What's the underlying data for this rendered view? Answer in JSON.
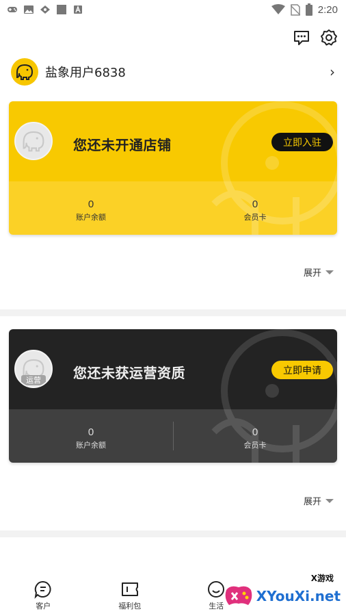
{
  "status_bar": {
    "time": "2:20",
    "left_icons": [
      "gamepad-icon",
      "image-icon",
      "signal-app-icon",
      "square-icon",
      "text-a-icon"
    ],
    "right_icons": [
      "wifi-icon",
      "no-sim-icon",
      "battery-icon"
    ]
  },
  "header": {
    "icons": [
      "message-icon",
      "settings-gear-icon"
    ]
  },
  "profile": {
    "username": "盐象用户6838",
    "accent": "#f8c901"
  },
  "shop_card": {
    "title": "您还未开通店铺",
    "button": "立即入驻",
    "stats": [
      {
        "value": "0",
        "label": "账户余额"
      },
      {
        "value": "0",
        "label": "会员卡"
      }
    ],
    "expand": "展开"
  },
  "ops_card": {
    "badge": "运营",
    "title": "您还未获运营资质",
    "button": "立即申请",
    "stats": [
      {
        "value": "0",
        "label": "账户余额"
      },
      {
        "value": "0",
        "label": "会员卡"
      }
    ],
    "expand": "展开"
  },
  "bottom_nav": {
    "items": [
      {
        "label": "客户",
        "icon": "chat-bubble-icon"
      },
      {
        "label": "福利包",
        "icon": "ticket-icon"
      },
      {
        "label": "生活",
        "icon": "smile-face-icon"
      }
    ]
  },
  "overlay": {
    "site": "XYouXi.net",
    "sub": "X游戏"
  },
  "colors": {
    "yellow": "#f8c901",
    "dark": "#232323",
    "gray": "#404040"
  }
}
